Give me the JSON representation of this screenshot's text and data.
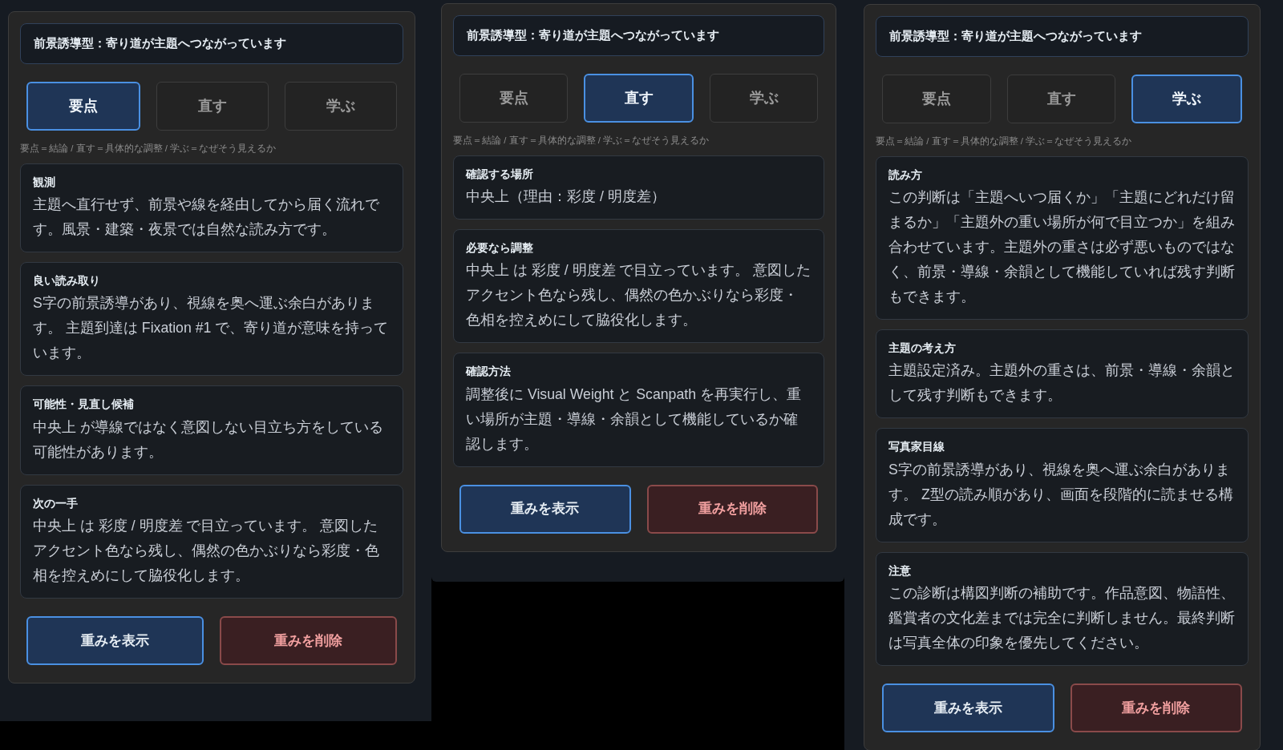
{
  "panels": [
    {
      "title": "前景誘導型：寄り道が主題へつながっています",
      "tabs": [
        {
          "label": "要点",
          "selected": true
        },
        {
          "label": "直す",
          "selected": false
        },
        {
          "label": "学ぶ",
          "selected": false
        }
      ],
      "hint": "要点＝結論 / 直す＝具体的な調整 / 学ぶ＝なぜそう見えるか",
      "sections": [
        {
          "heading": "観測",
          "body": "主題へ直行せず、前景や線を経由してから届く流れです。風景・建築・夜景では自然な読み方です。"
        },
        {
          "heading": "良い読み取り",
          "body": "S字の前景誘導があり、視線を奥へ運ぶ余白があります。 主題到達は Fixation #1 で、寄り道が意味を持っています。"
        },
        {
          "heading": "可能性・見直し候補",
          "body": "中央上 が導線ではなく意図しない目立ち方をしている可能性があります。"
        },
        {
          "heading": "次の一手",
          "body": "中央上 は 彩度 / 明度差 で目立っています。 意図したアクセント色なら残し、偶然の色かぶりなら彩度・色相を控えめにして脇役化します。"
        }
      ],
      "buttons": [
        {
          "label": "重みを表示",
          "kind": "primary"
        },
        {
          "label": "重みを削除",
          "kind": "danger"
        }
      ]
    },
    {
      "title": "前景誘導型：寄り道が主題へつながっています",
      "tabs": [
        {
          "label": "要点",
          "selected": false
        },
        {
          "label": "直す",
          "selected": true
        },
        {
          "label": "学ぶ",
          "selected": false
        }
      ],
      "hint": "要点＝結論 / 直す＝具体的な調整 / 学ぶ＝なぜそう見えるか",
      "sections": [
        {
          "heading": "確認する場所",
          "body": "中央上（理由：彩度 / 明度差）"
        },
        {
          "heading": "必要なら調整",
          "body": "中央上 は 彩度 / 明度差 で目立っています。 意図したアクセント色なら残し、偶然の色かぶりなら彩度・色相を控えめにして脇役化します。"
        },
        {
          "heading": "確認方法",
          "body": "調整後に Visual Weight と Scanpath を再実行し、重い場所が主題・導線・余韻として機能しているか確認します。"
        }
      ],
      "buttons": [
        {
          "label": "重みを表示",
          "kind": "primary"
        },
        {
          "label": "重みを削除",
          "kind": "danger"
        }
      ]
    },
    {
      "title": "前景誘導型：寄り道が主題へつながっています",
      "tabs": [
        {
          "label": "要点",
          "selected": false
        },
        {
          "label": "直す",
          "selected": false
        },
        {
          "label": "学ぶ",
          "selected": true
        }
      ],
      "hint": "要点＝結論 / 直す＝具体的な調整 / 学ぶ＝なぜそう見えるか",
      "sections": [
        {
          "heading": "読み方",
          "body": "この判断は「主題へいつ届くか」「主題にどれだけ留まるか」「主題外の重い場所が何で目立つか」を組み合わせています。主題外の重さは必ず悪いものではなく、前景・導線・余韻として機能していれば残す判断もできます。"
        },
        {
          "heading": "主題の考え方",
          "body": "主題設定済み。主題外の重さは、前景・導線・余韻として残す判断もできます。"
        },
        {
          "heading": "写真家目線",
          "body": "S字の前景誘導があり、視線を奥へ運ぶ余白があります。 Z型の読み順があり、画面を段階的に読ませる構成です。"
        },
        {
          "heading": "注意",
          "body": "この診断は構図判断の補助です。作品意図、物語性、鑑賞者の文化差までは完全に判断しません。最終判断は写真全体の印象を優先してください。"
        }
      ],
      "buttons": [
        {
          "label": "重みを表示",
          "kind": "primary"
        },
        {
          "label": "重みを削除",
          "kind": "danger"
        }
      ]
    }
  ]
}
